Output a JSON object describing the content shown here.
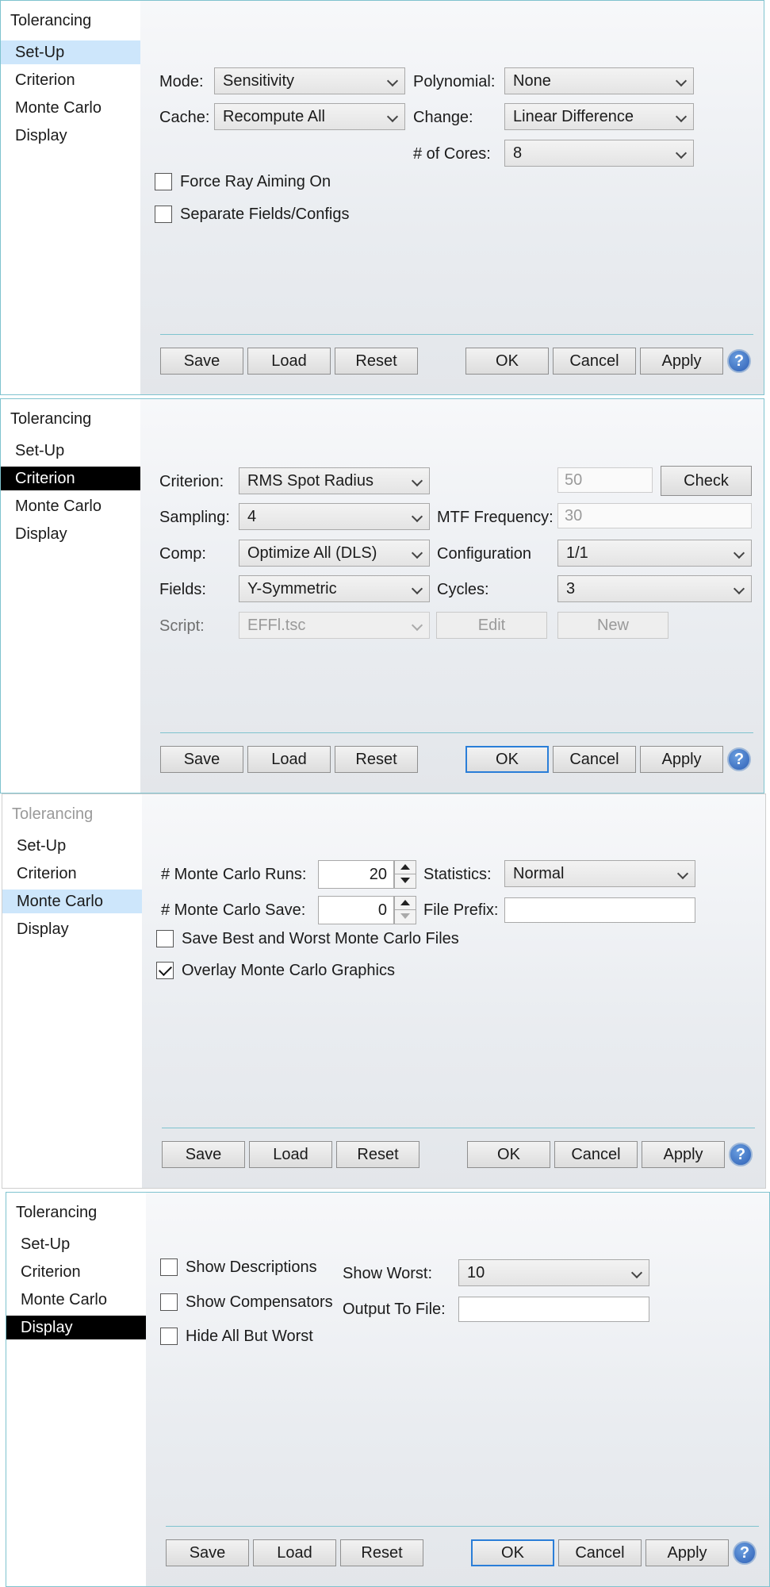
{
  "nav": [
    "Set-Up",
    "Criterion",
    "Monte Carlo",
    "Display"
  ],
  "title": "Tolerancing",
  "buttons": {
    "save": "Save",
    "load": "Load",
    "reset": "Reset",
    "ok": "OK",
    "cancel": "Cancel",
    "apply": "Apply",
    "help": "?"
  },
  "setup": {
    "mode_label": "Mode:",
    "mode_value": "Sensitivity",
    "polynomial_label": "Polynomial:",
    "polynomial_value": "None",
    "cache_label": "Cache:",
    "cache_value": "Recompute All",
    "change_label": "Change:",
    "change_value": "Linear Difference",
    "cores_label": "# of Cores:",
    "cores_value": "8",
    "force_ray_aiming": "Force Ray Aiming On",
    "separate_fields": "Separate Fields/Configs"
  },
  "criterion": {
    "criterion_label": "Criterion:",
    "criterion_value": "RMS Spot Radius",
    "check_value": "50",
    "check_button": "Check",
    "sampling_label": "Sampling:",
    "sampling_value": "4",
    "mtf_label": "MTF Frequency:",
    "mtf_value": "30",
    "comp_label": "Comp:",
    "comp_value": "Optimize All (DLS)",
    "config_label": "Configuration",
    "config_value": "1/1",
    "fields_label": "Fields:",
    "fields_value": "Y-Symmetric",
    "cycles_label": "Cycles:",
    "cycles_value": "3",
    "script_label": "Script:",
    "script_value": "EFFl.tsc",
    "edit_button": "Edit",
    "new_button": "New"
  },
  "montecarlo": {
    "runs_label": "# Monte Carlo Runs:",
    "runs_value": "20",
    "statistics_label": "Statistics:",
    "statistics_value": "Normal",
    "save_label": "# Monte Carlo Save:",
    "save_value": "0",
    "prefix_label": "File Prefix:",
    "prefix_value": "",
    "save_best_worst": "Save Best and Worst Monte Carlo Files",
    "overlay_graphics": "Overlay Monte Carlo Graphics"
  },
  "display": {
    "show_descriptions": "Show Descriptions",
    "show_compensators": "Show Compensators",
    "hide_all_but_worst": "Hide All But Worst",
    "show_worst_label": "Show Worst:",
    "show_worst_value": "10",
    "output_label": "Output To File:",
    "output_value": ""
  }
}
